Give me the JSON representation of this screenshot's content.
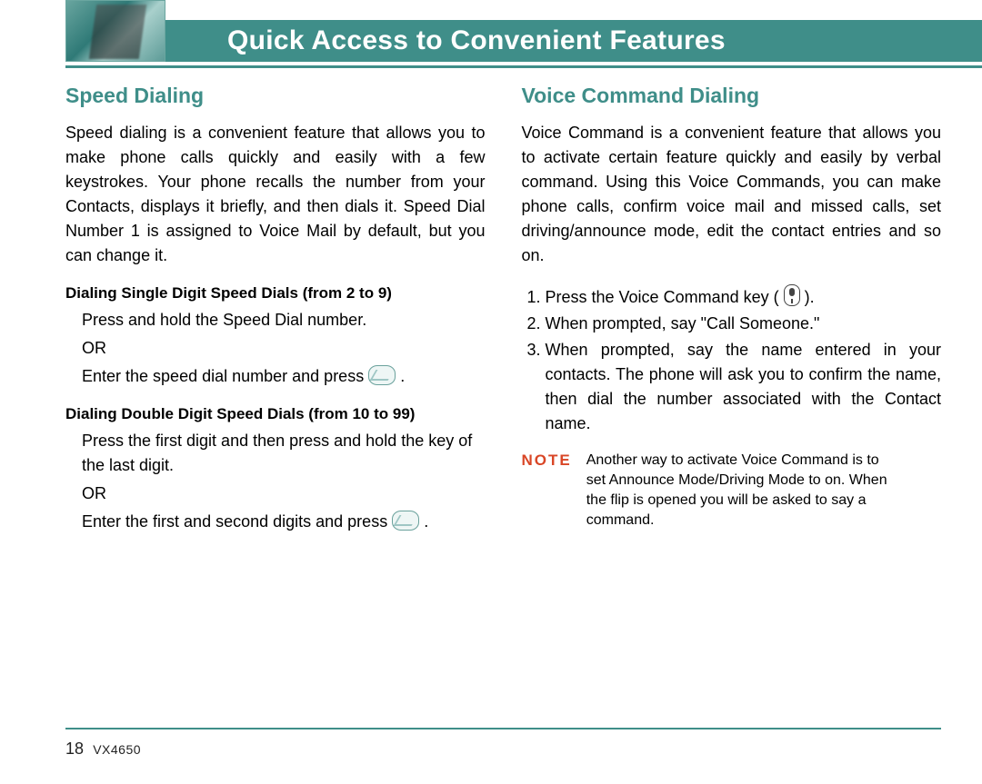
{
  "header": {
    "title": "Quick Access to Convenient Features"
  },
  "left": {
    "heading": "Speed Dialing",
    "intro": "Speed dialing is a convenient feature that allows you to make phone calls quickly and easily with a few keystrokes. Your phone recalls the number from your Contacts, displays it briefly, and then dials it. Speed Dial Number 1 is assigned to Voice Mail by default, but you can change it.",
    "sub1_head": "Dialing Single Digit Speed Dials (from 2 to 9)",
    "sub1_line1": "Press and hold the Speed Dial number.",
    "sub1_or": "OR",
    "sub1_line2a": "Enter the speed dial number and press ",
    "sub1_line2b": " .",
    "sub2_head": "Dialing Double Digit Speed Dials (from 10 to 99)",
    "sub2_line1": "Press the first digit and then press and hold the key of the last digit.",
    "sub2_or": "OR",
    "sub2_line2a": "Enter the first and second digits and press ",
    "sub2_line2b": " ."
  },
  "right": {
    "heading": "Voice Command Dialing",
    "intro": "Voice Command is a convenient feature that allows you to activate certain feature quickly and easily by verbal command. Using this Voice Commands, you can make phone calls, confirm voice mail and missed calls, set driving/announce mode, edit the contact entries and so on.",
    "step1a": "Press the Voice Command key ( ",
    "step1b": " ).",
    "step2": "When prompted, say \"Call Someone.\"",
    "step3": "When prompted, say the name entered in your contacts. The phone will ask you to confirm the name, then dial the number associated with the Contact name.",
    "note_label": "NOTE",
    "note_body": "Another way to activate Voice Command is to set Announce Mode/Driving Mode to on. When the flip is opened you will be asked to say a command."
  },
  "footer": {
    "page": "18",
    "model": "VX4650"
  },
  "icons": {
    "send_key": "send-key-icon",
    "voice_key": "voice-command-key-icon"
  }
}
